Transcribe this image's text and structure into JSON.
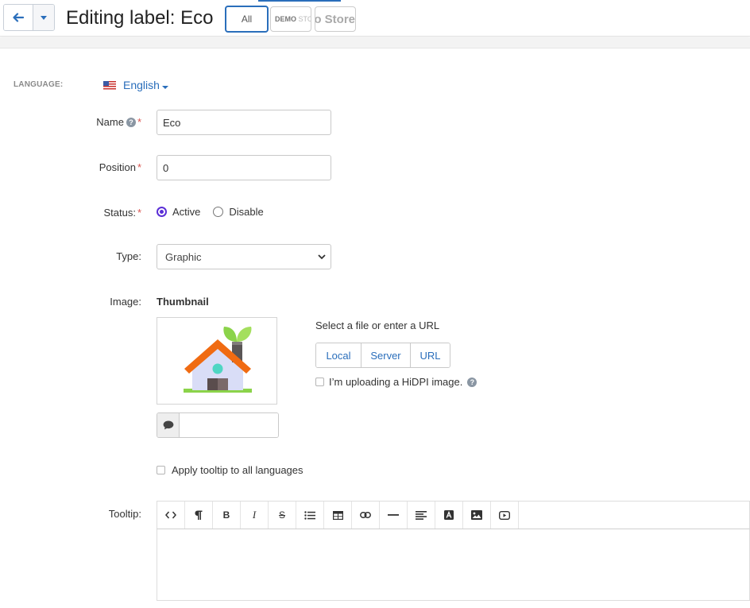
{
  "header": {
    "title": "Editing label: Eco",
    "stores": {
      "all_label": "All",
      "store1_label": "DEMO",
      "store1_faded": "STORE",
      "store2_label": "Demo Store"
    },
    "accent_color": "#2a6ebb"
  },
  "language": {
    "label": "LANGUAGE:",
    "value": "English",
    "flag_icon": "us-flag-icon"
  },
  "form": {
    "name": {
      "label": "Name",
      "value": "Eco"
    },
    "position": {
      "label": "Position",
      "value": "0"
    },
    "status": {
      "label": "Status:",
      "options": [
        "Active",
        "Disable"
      ],
      "selected": "Active"
    },
    "type": {
      "label": "Type:",
      "value": "Graphic"
    },
    "image": {
      "label": "Image:",
      "thumbnail_title": "Thumbnail",
      "file_hint": "Select a file or enter a URL",
      "buttons": [
        "Local",
        "Server",
        "URL"
      ],
      "hidpi_label": "I’m uploading a HiDPI image.",
      "alt_text_value": ""
    },
    "apply_tooltip_label": "Apply tooltip to all languages",
    "tooltip": {
      "label": "Tooltip:",
      "toolbar_icons": [
        "code-view-icon",
        "paragraph-icon",
        "bold-icon",
        "italic-icon",
        "strikethrough-icon",
        "bullet-list-icon",
        "table-icon",
        "link-icon",
        "horizontal-rule-icon",
        "align-icon",
        "font-color-icon",
        "image-icon",
        "video-icon"
      ],
      "content": ""
    }
  }
}
